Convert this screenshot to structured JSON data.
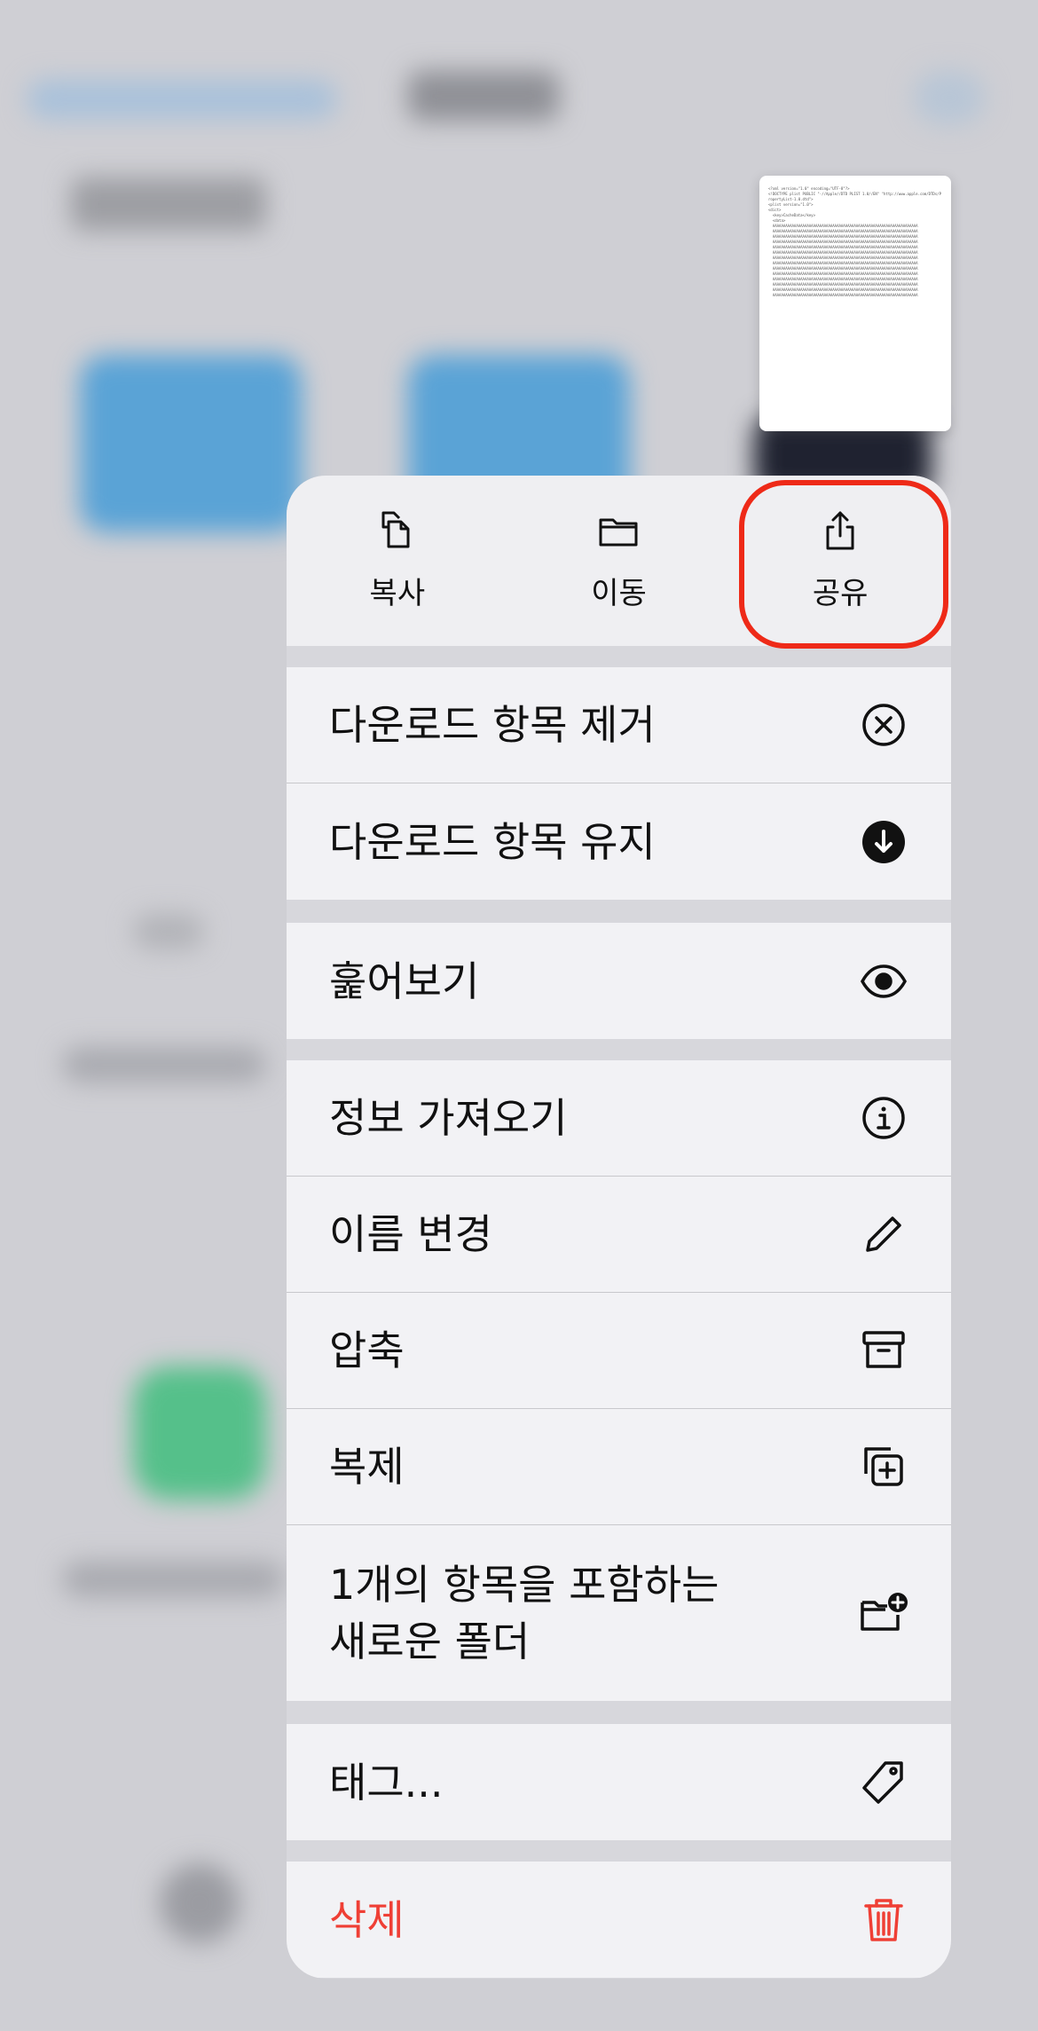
{
  "preview": {
    "text": "<?xml version=\"1.0\" encoding=\"UTF-8\"?>\n<!DOCTYPE plist PUBLIC \"-//Apple//DTD PLIST 1.0//EN\" \"http://www.apple.com/DTDs/PropertyList-1.0.dtd\">\n<plist version=\"1.0\">\n<dict>\n  <key>CacheData</key>\n  <data>\n  AAAAAAAAAAAAAAAAAAAAAAAAAAAAAAAAAAAAAAAAAAAAAAAAAAAAAAAAAAAAAAAAAAAA\n  AAAAAAAAAAAAAAAAAAAAAAAAAAAAAAAAAAAAAAAAAAAAAAAAAAAAAAAAAAAAAAAAAAAA\n  AAAAAAAAAAAAAAAAAAAAAAAAAAAAAAAAAAAAAAAAAAAAAAAAAAAAAAAAAAAAAAAAAAAA\n  AAAAAAAAAAAAAAAAAAAAAAAAAAAAAAAAAAAAAAAAAAAAAAAAAAAAAAAAAAAAAAAAAAAA\n  AAAAAAAAAAAAAAAAAAAAAAAAAAAAAAAAAAAAAAAAAAAAAAAAAAAAAAAAAAAAAAAAAAAA\n  AAAAAAAAAAAAAAAAAAAAAAAAAAAAAAAAAAAAAAAAAAAAAAAAAAAAAAAAAAAAAAAAAAAA\n  AAAAAAAAAAAAAAAAAAAAAAAAAAAAAAAAAAAAAAAAAAAAAAAAAAAAAAAAAAAAAAAAAAAA\n  AAAAAAAAAAAAAAAAAAAAAAAAAAAAAAAAAAAAAAAAAAAAAAAAAAAAAAAAAAAAAAAAAAAA\n  AAAAAAAAAAAAAAAAAAAAAAAAAAAAAAAAAAAAAAAAAAAAAAAAAAAAAAAAAAAAAAAAAAAA\n  AAAAAAAAAAAAAAAAAAAAAAAAAAAAAAAAAAAAAAAAAAAAAAAAAAAAAAAAAAAAAAAAAAAA\n  AAAAAAAAAAAAAAAAAAAAAAAAAAAAAAAAAAAAAAAAAAAAAAAAAAAAAAAAAAAAAAAAAAAA\n  AAAAAAAAAAAAAAAAAAAAAAAAAAAAAAAAAAAAAAAAAAAAAAAAAAAAAAAAAAAAAAAAAAAA\n  AAAAAAAAAAAAAAAAAAAAAAAAAAAAAAAAAAAAAAAAAAAAAAAAAAAAAAAAAAAAAAAAAAAA\n  AAAAAAAAAAAAAAAAAAAAAAAAAAAAAAAAAAAAAAAAAAAAAAAAAAAAAAAAAAAAAAAAAAAA"
  },
  "top_actions": [
    {
      "label": "복사",
      "icon": "copy-icon"
    },
    {
      "label": "이동",
      "icon": "folder-icon"
    },
    {
      "label": "공유",
      "icon": "share-icon"
    }
  ],
  "menu": {
    "remove_download": "다운로드 항목 제거",
    "keep_download": "다운로드 항목 유지",
    "quick_look": "훑어보기",
    "get_info": "정보 가져오기",
    "rename": "이름 변경",
    "compress": "압축",
    "duplicate": "복제",
    "new_folder_line1": "1개의 항목을 포함하는",
    "new_folder_line2": "새로운 폴더",
    "tags": "태그...",
    "delete": "삭제"
  },
  "colors": {
    "highlight": "#ee2a18",
    "delete": "#ef3f35"
  }
}
